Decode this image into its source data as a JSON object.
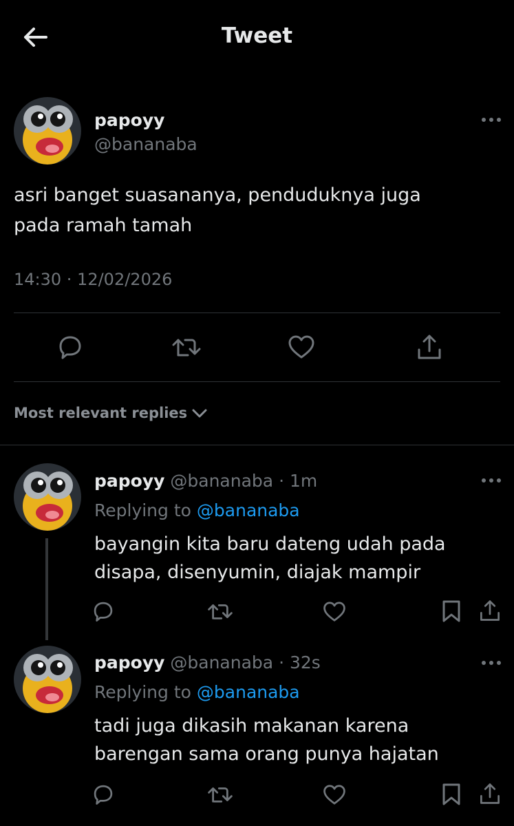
{
  "header": {
    "title": "Tweet",
    "back_icon": "arrow-left-icon"
  },
  "main_tweet": {
    "display_name": "papoyy",
    "handle": "@bananaba",
    "text": "asri banget suasananya, penduduknya juga pada ramah tamah",
    "timestamp": "14:30 · 12/02/2026",
    "more_icon": "more-horizontal-icon",
    "actions": [
      "reply-icon",
      "retweet-icon",
      "like-icon",
      "share-icon"
    ]
  },
  "replies_sort": {
    "label": "Most relevant replies",
    "icon": "chevron-down-icon"
  },
  "replies": [
    {
      "display_name": "papoyy",
      "handle": "@bananaba",
      "time": "1m",
      "replying_prefix": "Replying to",
      "replying_to": "@bananaba",
      "text": "bayangin kita baru dateng udah pada disapa, disenyumin, diajak mampir"
    },
    {
      "display_name": "papoyy",
      "handle": "@bananaba",
      "time": "32s",
      "replying_prefix": "Replying to",
      "replying_to": "@bananaba",
      "text": "tadi juga dikasih makanan karena barengan sama orang punya hajatan"
    }
  ],
  "colors": {
    "background": "#000000",
    "text": "#e7e9ea",
    "muted": "#71767b",
    "link": "#1d9bf0",
    "divider": "#2f3336"
  }
}
